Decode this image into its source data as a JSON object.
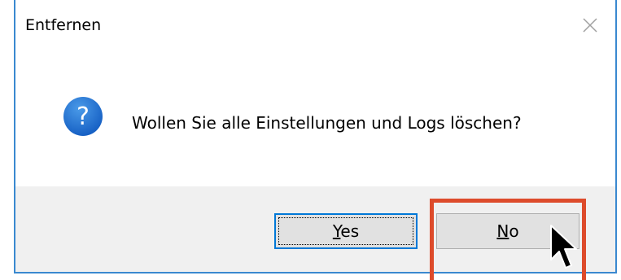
{
  "dialog": {
    "title": "Entfernen",
    "message": "Wollen Sie alle Einstellungen und Logs löschen?",
    "icon": "question-icon",
    "close_icon": "close-icon"
  },
  "buttons": {
    "yes": {
      "mnemonic": "Y",
      "rest": "es"
    },
    "no": {
      "mnemonic": "N",
      "rest": "o"
    }
  },
  "colors": {
    "window_border": "#3a89d0",
    "footer_background": "#f0f0f0",
    "button_background": "#e1e1e1",
    "default_button_border": "#0078d7",
    "question_icon": "#1a6fd0",
    "highlight_box": "#dd4b2b"
  }
}
